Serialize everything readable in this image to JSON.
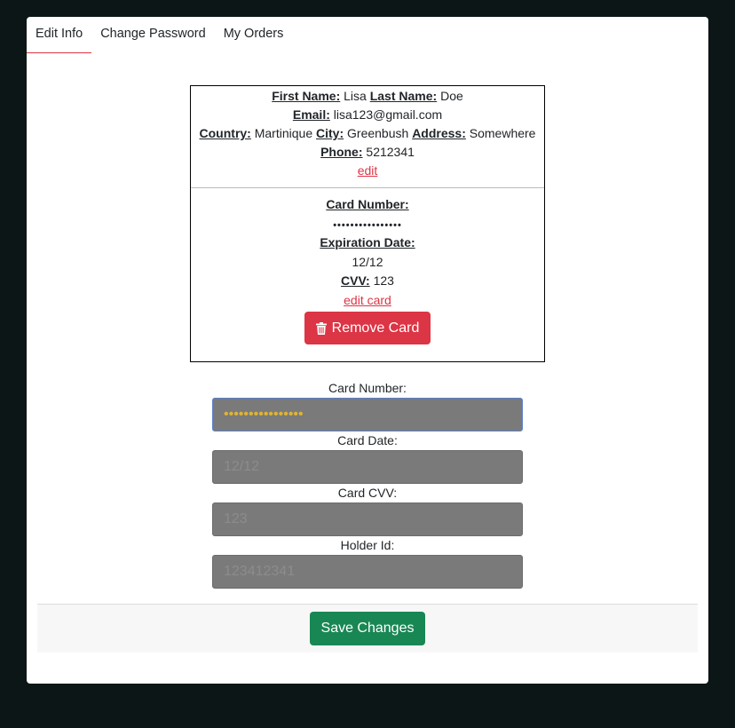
{
  "tabs": [
    {
      "label": "Edit Info"
    },
    {
      "label": "Change Password"
    },
    {
      "label": "My Orders"
    }
  ],
  "info": {
    "first_name_label": "First Name:",
    "first_name": "Lisa",
    "last_name_label": "Last Name:",
    "last_name": "Doe",
    "email_label": "Email:",
    "email": "lisa123@gmail.com",
    "country_label": "Country:",
    "country": "Martinique",
    "city_label": "City:",
    "city": "Greenbush",
    "address_label": "Address:",
    "address": "Somewhere",
    "phone_label": "Phone:",
    "phone": "5212341",
    "edit_link": "edit"
  },
  "card": {
    "number_label": "Card Number:",
    "number_masked": "••••••••••••••••",
    "expiration_label": "Expiration Date:",
    "expiration": "12/12",
    "cvv_label": "CVV:",
    "cvv": "123",
    "edit_link": "edit card",
    "remove_button": "Remove Card"
  },
  "form": {
    "card_number_label": "Card Number:",
    "card_number_value": "••••••••••••••••",
    "card_date_label": "Card Date:",
    "card_date_placeholder": "12/12",
    "card_cvv_label": "Card CVV:",
    "card_cvv_placeholder": "123",
    "holder_id_label": "Holder Id:",
    "holder_id_placeholder": "123412341"
  },
  "footer": {
    "save_button": "Save Changes"
  },
  "colors": {
    "accent_red": "#dc3545",
    "save_green": "#198754",
    "page_bg": "#0c1616"
  }
}
